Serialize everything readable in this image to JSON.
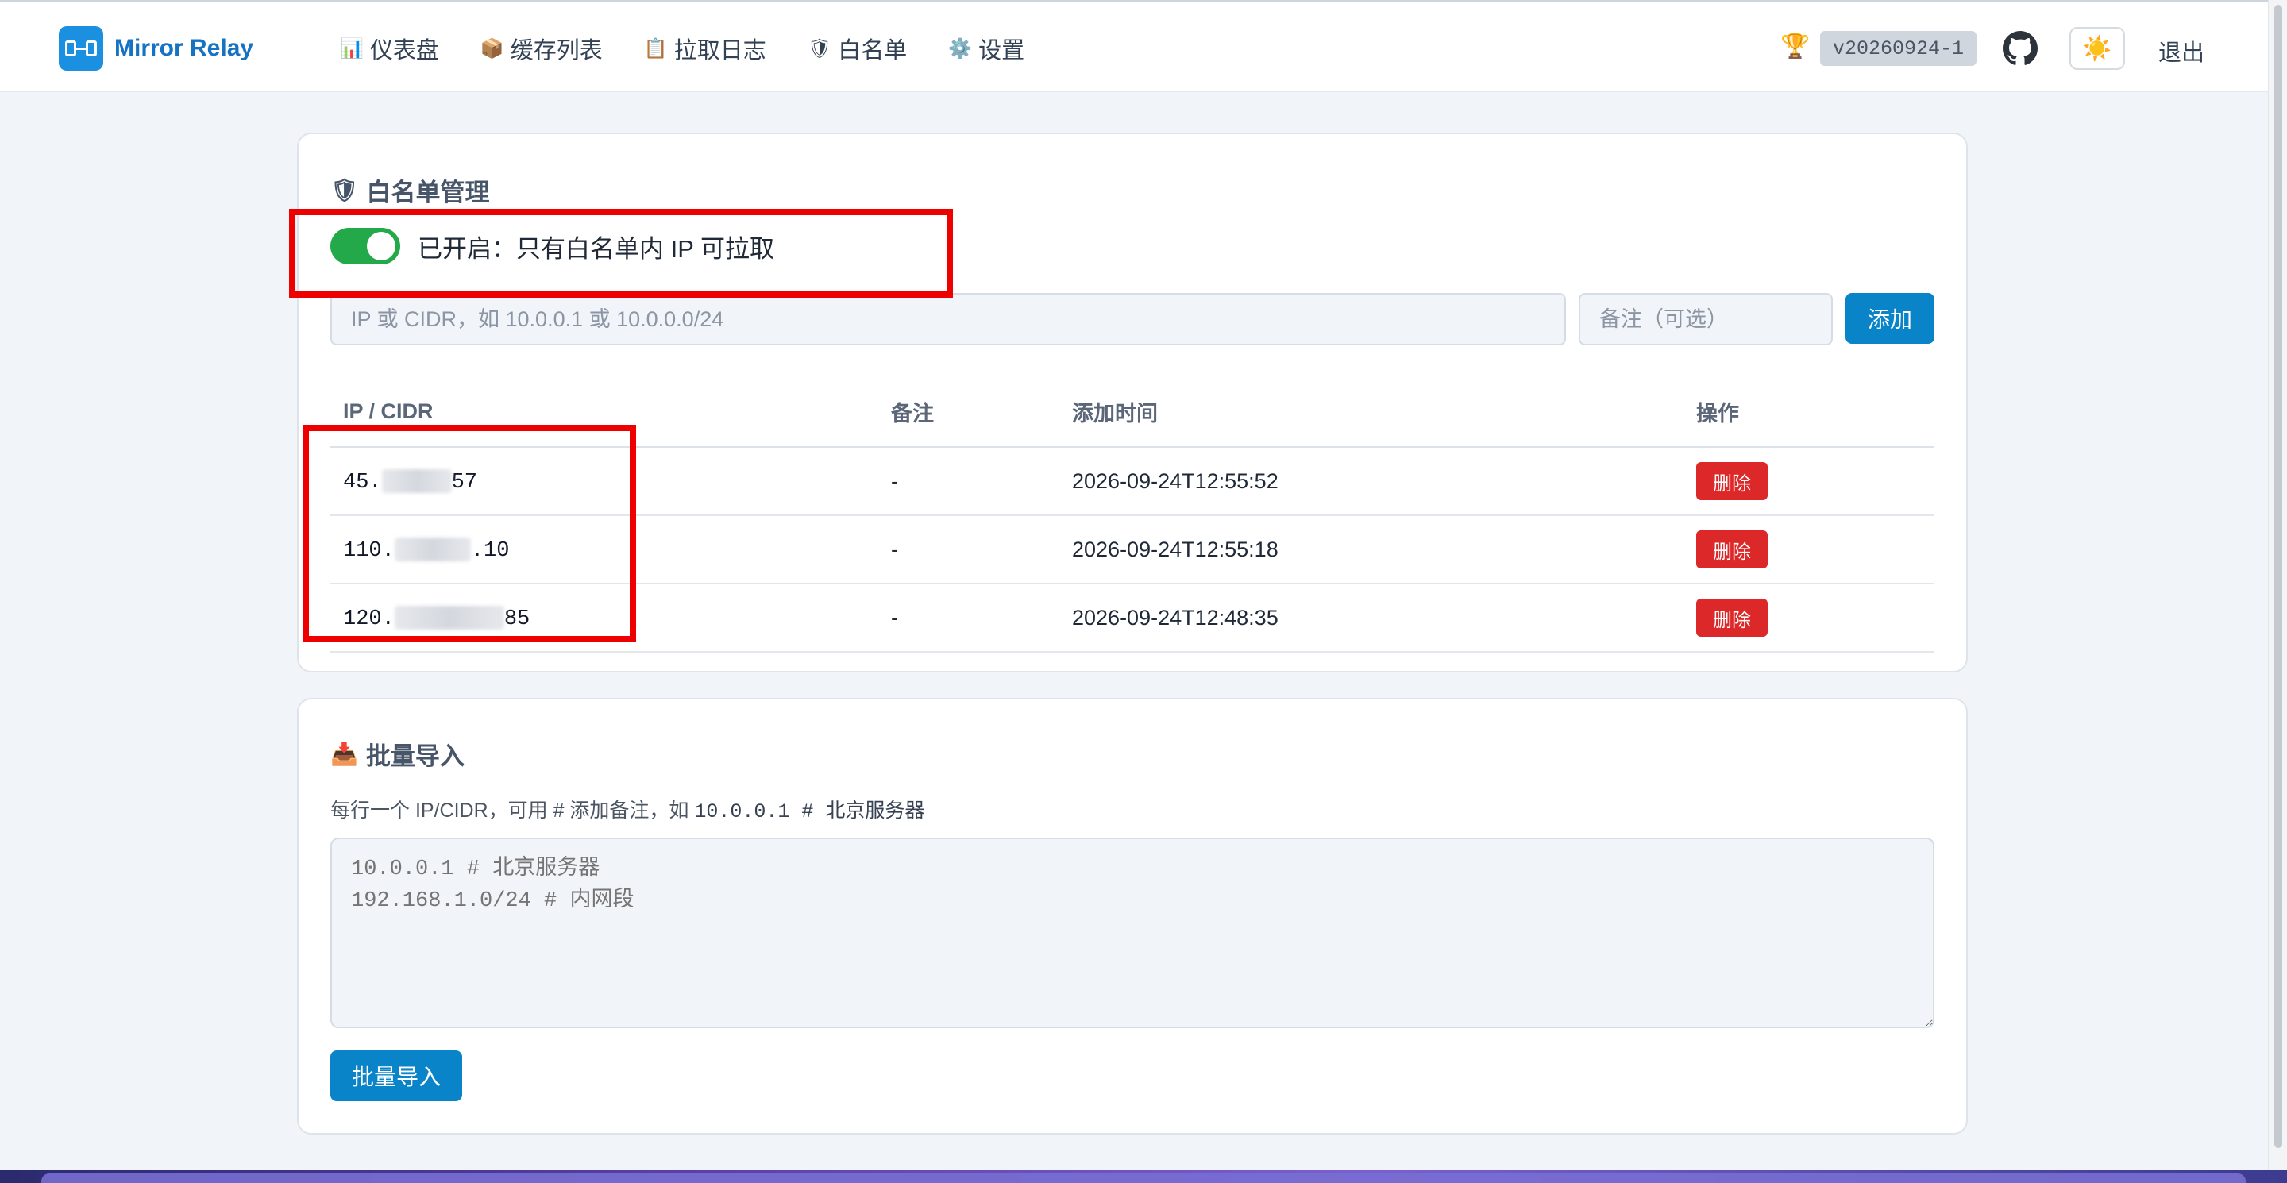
{
  "app": {
    "brand": "Mirror Relay",
    "version": "v20260924-1",
    "logout": "退出"
  },
  "nav": [
    {
      "icon": "📊",
      "icon_name": "bar-chart-icon",
      "label": "仪表盘"
    },
    {
      "icon": "📦",
      "icon_name": "package-icon",
      "label": "缓存列表"
    },
    {
      "icon": "📋",
      "icon_name": "log-icon",
      "label": "拉取日志"
    },
    {
      "icon": "🛡",
      "icon_name": "shield-icon",
      "label": "白名单"
    },
    {
      "icon": "⚙️",
      "icon_name": "gear-icon",
      "label": "设置"
    }
  ],
  "whitelist": {
    "title": "白名单管理",
    "title_icon": "🛡",
    "toggle_on": true,
    "toggle_label": "已开启：只有白名单内 IP 可拉取",
    "ip_placeholder": "IP 或 CIDR，如 10.0.0.1 或 10.0.0.0/24",
    "note_placeholder": "备注（可选）",
    "add_label": "添加",
    "columns": [
      "IP / CIDR",
      "备注",
      "添加时间",
      "操作"
    ],
    "rows": [
      {
        "ip_prefix": "45.",
        "ip_suffix": "57",
        "note": "-",
        "time": "2026-09-24T12:55:52",
        "action": "删除"
      },
      {
        "ip_prefix": "110.",
        "ip_suffix": ".10",
        "note": "-",
        "time": "2026-09-24T12:55:18",
        "action": "删除"
      },
      {
        "ip_prefix": "120.",
        "ip_suffix": "85",
        "note": "-",
        "time": "2026-09-24T12:48:35",
        "action": "删除"
      }
    ]
  },
  "bulk": {
    "title": "批量导入",
    "title_icon": "📥",
    "hint_pre": "每行一个 IP/CIDR，可用 # 添加备注，如 ",
    "hint_code": "10.0.0.1 # 北京服务器",
    "placeholder": "10.0.0.1 # 北京服务器\n192.168.1.0/24 # 内网段",
    "button": "批量导入"
  },
  "colors": {
    "accent": "#0a84c8",
    "toggle_on": "#23a94a",
    "danger": "#dc2828",
    "highlight": "#ee0000"
  }
}
